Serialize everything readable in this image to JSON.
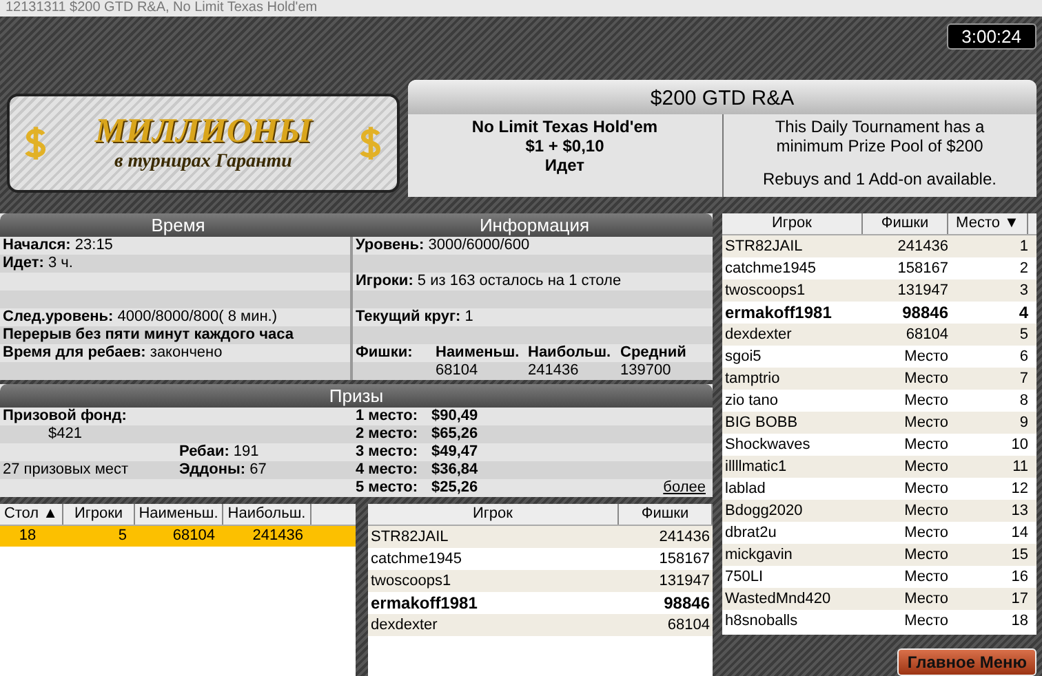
{
  "window": {
    "title": "12131311 $200 GTD R&A, No Limit Texas Hold'em"
  },
  "timer": "3:00:24",
  "banner": {
    "title": "МИЛЛИОНЫ",
    "subtitle": "в турнирах Гаранти"
  },
  "tournament": {
    "title": "$200 GTD R&A",
    "game": "No Limit Texas Hold'em",
    "buyin": "$1 + $0,10",
    "status": "Идет",
    "description": "This Daily Tournament has a minimum Prize Pool of $200",
    "note": "Rebuys and 1 Add-on available."
  },
  "time_panel": {
    "title": "Время",
    "items": [
      {
        "label": "Начался:",
        "value": "23:15"
      },
      {
        "label": "Идет:",
        "value": "3 ч."
      },
      {
        "label": "След.уровень:",
        "value": "4000/8000/800( 8 мин.)"
      },
      {
        "label": "Перерыв без пяти минут каждого часа"
      },
      {
        "label": "Время для ребаев:",
        "value": "закончено"
      }
    ]
  },
  "info_panel": {
    "title": "Информация",
    "items": [
      {
        "label": "Уровень:",
        "value": "3000/6000/600"
      },
      {
        "label": "Игроки:",
        "value": "5 из 163 осталось на 1 столе"
      },
      {
        "label": "Текущий круг:",
        "value": "1"
      }
    ],
    "chips": {
      "label": "Фишки:",
      "columns": [
        {
          "heading": "Наименьш.",
          "value": "68104"
        },
        {
          "heading": "Наибольш.",
          "value": "241436"
        },
        {
          "heading": "Средний",
          "value": "139700"
        }
      ]
    }
  },
  "prizes": {
    "title": "Призы",
    "pool_label": "Призовой фонд:",
    "pool": "$421",
    "places_count": "27 призовых мест",
    "rebuys_label": "Ребаи:",
    "rebuys": "191",
    "addons_label": "Эддоны:",
    "addons": "67",
    "places": [
      {
        "label": "1 место:",
        "amount": "$90,49"
      },
      {
        "label": "2 место:",
        "amount": "$65,26"
      },
      {
        "label": "3 место:",
        "amount": "$49,47"
      },
      {
        "label": "4 место:",
        "amount": "$36,84"
      },
      {
        "label": "5 место:",
        "amount": "$25,26"
      }
    ],
    "more_link": "более"
  },
  "tables": {
    "columns": [
      {
        "label": "Стол",
        "sort_mark": "▲"
      },
      {
        "label": "Игроки"
      },
      {
        "label": "Наименьш."
      },
      {
        "label": "Наибольш."
      }
    ],
    "rows": [
      {
        "cells": [
          "18",
          "5",
          "68104",
          "241436"
        ],
        "selected": true
      }
    ]
  },
  "table_players": {
    "columns": [
      "Игрок",
      "Фишки"
    ],
    "rows": [
      {
        "name": "STR82JAIL",
        "chips": "241436",
        "current": false
      },
      {
        "name": "catchme1945",
        "chips": "158167",
        "current": false
      },
      {
        "name": "twoscoops1",
        "chips": "131947",
        "current": false
      },
      {
        "name": "ermakoff1981",
        "chips": "98846",
        "current": true
      },
      {
        "name": "dexdexter",
        "chips": "68104",
        "current": false
      }
    ]
  },
  "standings": {
    "columns": [
      {
        "label": "Игрок"
      },
      {
        "label": "Фишки"
      },
      {
        "label": "Место",
        "sort_mark": "▼"
      }
    ],
    "rows": [
      {
        "name": "STR82JAIL",
        "chips": "241436",
        "place": "1",
        "current": false
      },
      {
        "name": "catchme1945",
        "chips": "158167",
        "place": "2",
        "current": false
      },
      {
        "name": "twoscoops1",
        "chips": "131947",
        "place": "3",
        "current": false
      },
      {
        "name": "ermakoff1981",
        "chips": "98846",
        "place": "4",
        "current": true
      },
      {
        "name": "dexdexter",
        "chips": "68104",
        "place": "5",
        "current": false
      },
      {
        "name": "sgoi5",
        "chips": "Место",
        "place": "6",
        "current": false
      },
      {
        "name": "tamptrio",
        "chips": "Место",
        "place": "7",
        "current": false
      },
      {
        "name": "zio tano",
        "chips": "Место",
        "place": "8",
        "current": false
      },
      {
        "name": "BIG BOBB",
        "chips": "Место",
        "place": "9",
        "current": false
      },
      {
        "name": "Shockwaves",
        "chips": "Место",
        "place": "10",
        "current": false
      },
      {
        "name": "illllmatic1",
        "chips": "Место",
        "place": "11",
        "current": false
      },
      {
        "name": "lablad",
        "chips": "Место",
        "place": "12",
        "current": false
      },
      {
        "name": "Bdogg2020",
        "chips": "Место",
        "place": "13",
        "current": false
      },
      {
        "name": "dbrat2u",
        "chips": "Место",
        "place": "14",
        "current": false
      },
      {
        "name": "mickgavin",
        "chips": "Место",
        "place": "15",
        "current": false
      },
      {
        "name": "750LI",
        "chips": "Место",
        "place": "16",
        "current": false
      },
      {
        "name": "WastedMnd420",
        "chips": "Место",
        "place": "17",
        "current": false
      },
      {
        "name": "h8snoballs",
        "chips": "Место",
        "place": "18",
        "current": false
      }
    ]
  },
  "main_menu_button": "Главное Меню"
}
